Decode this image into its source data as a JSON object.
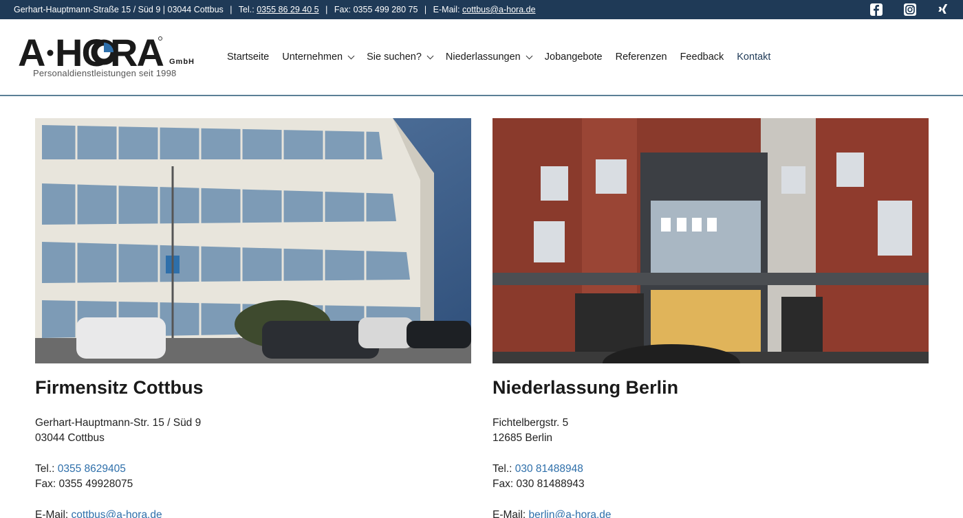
{
  "topbar": {
    "address": "Gerhart-Hauptmann-Straße 15 / Süd 9 | 03044 Cottbus",
    "tel_label": "Tel.:",
    "tel_value": "0355 86 29 40 5",
    "fax": "Fax: 0355 499 280 75",
    "email_label": "E-Mail:",
    "email_value": "cottbus@a-hora.de",
    "separator": "|",
    "bg_color": "#1f3a57"
  },
  "logo": {
    "name_part1": "A",
    "name_part2": "HORA",
    "suffix": "GmbH",
    "tagline": "Personaldienstleistungen seit 1998"
  },
  "nav": {
    "items": [
      {
        "label": "Startseite"
      },
      {
        "label": "Unternehmen"
      },
      {
        "label": "Sie suchen?"
      },
      {
        "label": "Niederlassungen"
      },
      {
        "label": "Jobangebote"
      },
      {
        "label": "Referenzen"
      },
      {
        "label": "Feedback"
      },
      {
        "label": "Kontakt"
      }
    ]
  },
  "locations": [
    {
      "title": "Firmensitz Cottbus",
      "street": "Gerhart-Hauptmann-Str. 15 / Süd 9",
      "city": "03044 Cottbus",
      "tel_label": "Tel.:",
      "tel_value": "0355 8629405",
      "fax": "Fax: 0355 49928075",
      "email_label": "E-Mail:",
      "email_value": "cottbus@a-hora.de"
    },
    {
      "title": "Niederlassung Berlin",
      "street": "Fichtelbergstr. 5",
      "city": "12685 Berlin",
      "tel_label": "Tel.:",
      "tel_value": "030 81488948",
      "fax": "Fax: 030 81488943",
      "email_label": "E-Mail:",
      "email_value": "berlin@a-hora.de"
    }
  ],
  "icons": [
    "facebook-icon",
    "instagram-icon",
    "xing-icon"
  ],
  "colors": {
    "link": "#2e6faa",
    "header_border": "#5b7f95"
  }
}
